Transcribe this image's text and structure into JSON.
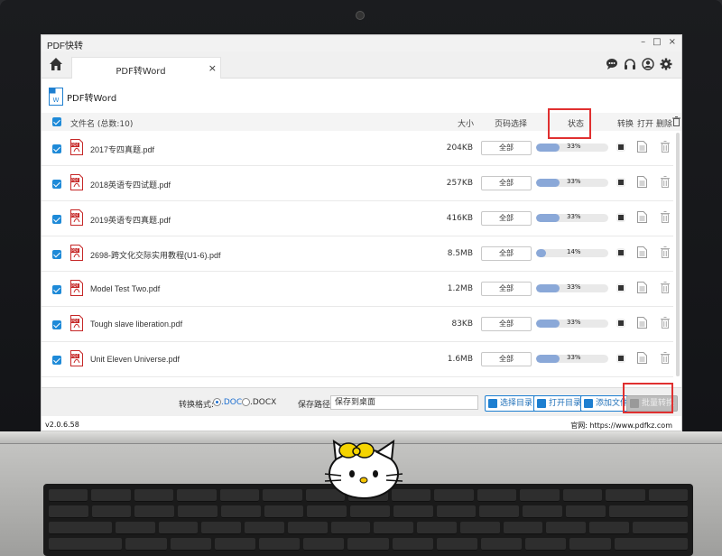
{
  "app": {
    "title": "PDF快转",
    "version": "v2.0.6.58"
  },
  "window_controls": {
    "minimize": "–",
    "maximize": "□",
    "close": "×"
  },
  "tab": {
    "label": "PDF转Word",
    "close": "×"
  },
  "header": {
    "title": "PDF转Word"
  },
  "columns": {
    "filename": "文件名 (总数:10)",
    "size": "大小",
    "pages": "页码选择",
    "status": "状态",
    "convert": "转换",
    "open": "打开",
    "delete": "删除"
  },
  "files": [
    {
      "name": "2017专四真题.pdf",
      "size": "204KB",
      "pages": "全部",
      "progress": 33,
      "progress_text": "33%"
    },
    {
      "name": "2018英语专四试题.pdf",
      "size": "257KB",
      "pages": "全部",
      "progress": 33,
      "progress_text": "33%"
    },
    {
      "name": "2019英语专四真题.pdf",
      "size": "416KB",
      "pages": "全部",
      "progress": 33,
      "progress_text": "33%"
    },
    {
      "name": "2698-跨文化交际实用教程(U1-6).pdf",
      "size": "8.5MB",
      "pages": "全部",
      "progress": 14,
      "progress_text": "14%"
    },
    {
      "name": "Model Test Two.pdf",
      "size": "1.2MB",
      "pages": "全部",
      "progress": 33,
      "progress_text": "33%"
    },
    {
      "name": "Tough slave liberation.pdf",
      "size": "83KB",
      "pages": "全部",
      "progress": 33,
      "progress_text": "33%"
    },
    {
      "name": "Unit Eleven Universe.pdf",
      "size": "1.6MB",
      "pages": "全部",
      "progress": 33,
      "progress_text": "33%"
    }
  ],
  "footer": {
    "format_label": "转换格式:",
    "format_doc": ".DOC",
    "format_docx": ".DOCX",
    "save_path_label": "保存路径:",
    "save_path_value": "保存到桌面",
    "choose_dir": "选择目录",
    "open_dir": "打开目录",
    "add_file": "添加文件",
    "batch_convert": "批量转换"
  },
  "status_bar": {
    "website": "官网: https://www.pdfkz.com"
  },
  "colors": {
    "accent": "#1e7fd0",
    "progress": "#8aa8d8",
    "highlight": "#e03030"
  }
}
